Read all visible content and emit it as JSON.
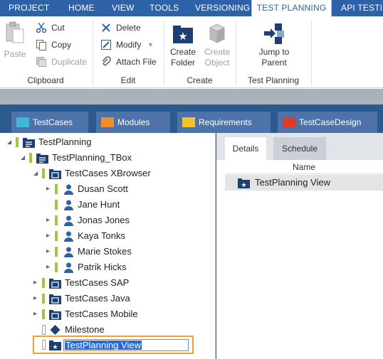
{
  "ribbon_tabs": [
    "PROJECT",
    "HOME",
    "VIEW",
    "TOOLS",
    "VERSIONING",
    "TEST PLANNING",
    "API TESTIN"
  ],
  "active_tab": "TEST PLANNING",
  "clipboard": {
    "paste_label": "Paste",
    "cut_label": "Cut",
    "copy_label": "Copy",
    "duplicate_label": "Duplicate",
    "group_label": "Clipboard"
  },
  "edit": {
    "delete_label": "Delete",
    "modify_label": "Modify",
    "attach_label": "Attach File",
    "group_label": "Edit"
  },
  "create": {
    "create_folder_line1": "Create",
    "create_folder_line2": "Folder",
    "create_object_line1": "Create",
    "create_object_line2": "Object",
    "group_label": "Create"
  },
  "testplanning": {
    "jump_line1": "Jump to",
    "jump_line2": "Parent",
    "group_label": "Test Planning"
  },
  "pane_tabs": [
    {
      "label": "TestCases",
      "color": "#3fb8d8"
    },
    {
      "label": "Modules",
      "color": "#f28a2e"
    },
    {
      "label": "Requirements",
      "color": "#f5c02c"
    },
    {
      "label": "TestCaseDesign",
      "color": "#e03b2a"
    }
  ],
  "tree": [
    {
      "label": "TestPlanning"
    },
    {
      "label": "TestPlanning_TBox"
    },
    {
      "label": "TestCases XBrowser"
    },
    {
      "label": "Dusan Scott"
    },
    {
      "label": "Jane Hunt"
    },
    {
      "label": "Jonas Jones"
    },
    {
      "label": "Kaya Tonks"
    },
    {
      "label": "Marie Stokes"
    },
    {
      "label": "Patrik Hicks"
    },
    {
      "label": "TestCases SAP"
    },
    {
      "label": "TestCases Java"
    },
    {
      "label": "TestCases Mobile"
    },
    {
      "label": "Milestone"
    },
    {
      "label": "TestPlanning View",
      "editing": true
    }
  ],
  "details": {
    "tabs": [
      "Details",
      "Schedule"
    ],
    "column_header": "Name",
    "rows": [
      "TestPlanning View"
    ]
  },
  "colors": {
    "ribbon_blue": "#2d62a8",
    "selection_orange": "#f0a030",
    "green_bar": "#9ec93f",
    "navy_icon": "#1d3f73"
  }
}
